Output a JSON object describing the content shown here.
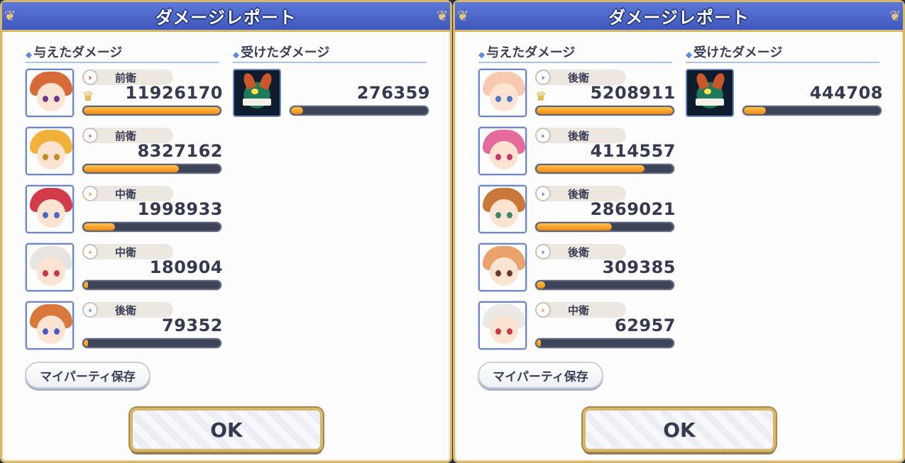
{
  "panels": [
    {
      "title": "ダメージレポート",
      "dealt_label": "与えたダメージ",
      "taken_label": "受けたダメージ",
      "dealt": [
        {
          "position": "前衛",
          "pos_color": "#e05d5d",
          "damage": "11926170",
          "fill": 1.0,
          "top": true,
          "hair": "#d86a3a",
          "eyes": "#6a3a8a"
        },
        {
          "position": "前衛",
          "pos_color": "#e05d5d",
          "damage": "8327162",
          "fill": 0.7,
          "top": false,
          "hair": "#f2b23a",
          "eyes": "#c88a1a"
        },
        {
          "position": "中衛",
          "pos_color": "#e0a63a",
          "damage": "1998933",
          "fill": 0.23,
          "top": false,
          "hair": "#d23c4a",
          "eyes": "#4a6ac8"
        },
        {
          "position": "中衛",
          "pos_color": "#e0a63a",
          "damage": "180904",
          "fill": 0.03,
          "top": false,
          "hair": "#e8e4e2",
          "eyes": "#c83a4a"
        },
        {
          "position": "後衛",
          "pos_color": "#4a8ee0",
          "damage": "79352",
          "fill": 0.02,
          "top": false,
          "hair": "#d8783a",
          "eyes": "#4a5ac8"
        }
      ],
      "taken": {
        "damage": "276359",
        "fill": 0.09
      },
      "party_button": "マイパーティ保存",
      "ok_button": "OK"
    },
    {
      "title": "ダメージレポート",
      "dealt_label": "与えたダメージ",
      "taken_label": "受けたダメージ",
      "dealt": [
        {
          "position": "後衛",
          "pos_color": "#4a8ee0",
          "damage": "5208911",
          "fill": 1.0,
          "top": true,
          "hair": "#f7c9b0",
          "eyes": "#4a7ac8"
        },
        {
          "position": "後衛",
          "pos_color": "#4a8ee0",
          "damage": "4114557",
          "fill": 0.79,
          "top": false,
          "hair": "#e56b9a",
          "eyes": "#c83a6a"
        },
        {
          "position": "後衛",
          "pos_color": "#4a8ee0",
          "damage": "2869021",
          "fill": 0.55,
          "top": false,
          "hair": "#c9783a",
          "eyes": "#3a8a6a"
        },
        {
          "position": "後衛",
          "pos_color": "#4a8ee0",
          "damage": "309385",
          "fill": 0.06,
          "top": false,
          "hair": "#e8a26a",
          "eyes": "#6a3a2a"
        },
        {
          "position": "中衛",
          "pos_color": "#e0a63a",
          "damage": "62957",
          "fill": 0.02,
          "top": false,
          "hair": "#ece8e6",
          "eyes": "#c83a4a"
        }
      ],
      "taken": {
        "damage": "444708",
        "fill": 0.16
      },
      "party_button": "マイパーティ保存",
      "ok_button": "OK"
    }
  ]
}
